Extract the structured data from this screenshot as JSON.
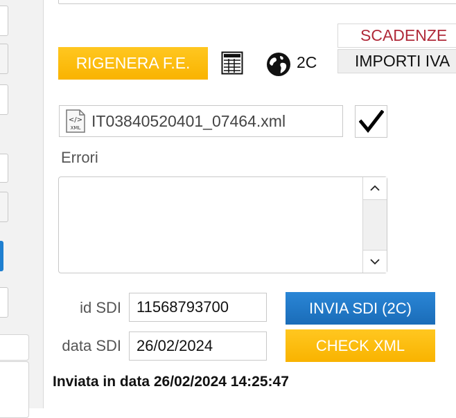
{
  "toolbar": {
    "rigenera_label": "RIGENERA F.E.",
    "grid_icon": "spreadsheet-icon",
    "globe_icon": "globe-icon",
    "channel_label": "2C"
  },
  "tabs": [
    {
      "label": "SCADENZE",
      "active": true
    },
    {
      "label": "IMPORTI IVA",
      "active": false
    }
  ],
  "file": {
    "icon": "xml-file-icon",
    "name": "IT03840520401_07464.xml",
    "checked": true
  },
  "errors": {
    "label": "Errori",
    "value": ""
  },
  "sdi": {
    "id_label": "id SDI",
    "id_value": "11568793700",
    "date_label": "data SDI",
    "date_value": "26/02/2024",
    "send_button": "INVIA SDI (2C)",
    "check_button": "CHECK XML"
  },
  "status": {
    "sent_text": "Inviata in data 26/02/2024 14:25:47"
  },
  "colors": {
    "accent_yellow": "#f9b300",
    "accent_blue": "#1a6cb8",
    "active_tab_text": "#b02a3a"
  }
}
